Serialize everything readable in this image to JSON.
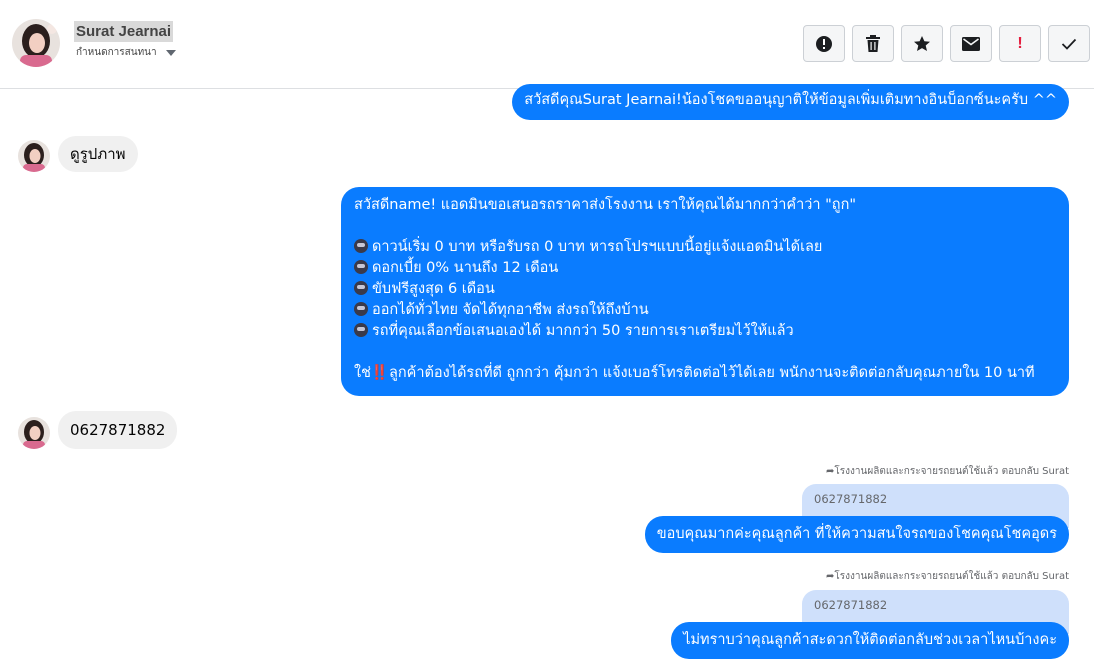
{
  "header": {
    "contact_name": "Surat Jearnai",
    "assign_label": "กำหนดการสนทนา",
    "actions": [
      {
        "icon": "alert-circle-icon",
        "name": "mark-spam-button"
      },
      {
        "icon": "trash-icon",
        "name": "delete-button"
      },
      {
        "icon": "star-icon",
        "name": "star-button"
      },
      {
        "icon": "envelope-icon",
        "name": "mark-unread-button"
      },
      {
        "icon": "exclamation-icon",
        "name": "mark-important-button"
      },
      {
        "icon": "check-icon",
        "name": "mark-done-button"
      }
    ]
  },
  "messages": {
    "m1_out": "สวัสดีคุณSurat Jearnai!น้องโชคขออนุญาติให้ข้อมูลเพิ่มเติมทางอินบ็อกซ์นะครับ ^^",
    "m2_in": "ดูรูปภาพ",
    "m3_out": {
      "line1": "สวัสดีname! แอดมินขอเสนอรถราคาส่งโรงงาน เราให้คุณได้มากกว่าคำว่า \"ถูก\"",
      "bullets": [
        "ดาวน์เริ่ม 0 บาท หรือรับรถ 0 บาท หารถโปรฯแบบนี้อยู่แจ้งแอดมินได้เลย",
        "ดอกเบี้ย 0% นานถึง 12 เดือน",
        "ขับฟรีสูงสุด 6 เดือน",
        "ออกได้ทั่วไทย จัดได้ทุกอาชีพ ส่งรถให้ถึงบ้าน",
        "รถที่คุณเลือกข้อเสนอเองได้ มากกว่า 50 รายการเราเตรียมไว้ให้แล้ว"
      ],
      "last_prefix": "ใช่",
      "last_bangs": "‼️",
      "last_rest": "ลูกค้าต้องได้รถที่ดี ถูกกว่า คุ้มกว่า แจ้งเบอร์โทรติดต่อไว้ได้เลย พนักงานจะติดต่อกลับคุณภายใน 10 นาที"
    },
    "m4_in": "0627871882",
    "reply1": {
      "meta": "โรงงานผลิตและกระจายรถยนต์ใช้แล้ว ตอบกลับ Surat",
      "quoted": "0627871882",
      "text": "ขอบคุณมากค่ะคุณลูกค้า ที่ให้ความสนใจรถของโชคคุณโชคอุดร"
    },
    "reply2": {
      "meta": "โรงงานผลิตและกระจายรถยนต์ใช้แล้ว ตอบกลับ Surat",
      "quoted": "0627871882",
      "text": "ไม่ทราบว่าคุณลูกค้าสะดวกให้ติดต่อกลับช่วงเวลาไหนบ้างคะ"
    }
  },
  "colors": {
    "outgoing": "#0a7cff",
    "incoming": "#f0f0f0",
    "quoted": "#cfe0fb"
  }
}
